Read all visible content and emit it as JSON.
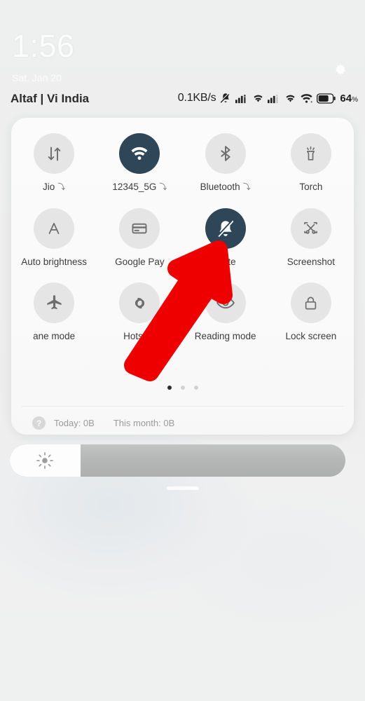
{
  "lockscreen": {
    "clock": "1:56",
    "date": "Sat, Jan 20",
    "carrier": "Altaf | Vi India",
    "settings_icon": "gear-icon"
  },
  "statusbar": {
    "network_speed": "0.1KB/s",
    "icons": [
      "mute-bell-icon",
      "signal-bars-icon",
      "data-3g-icon",
      "signal-bars-icon",
      "data-3g-icon",
      "wifi-icon",
      "battery-icon"
    ],
    "battery_percent": "64",
    "battery_percent_symbol": "%"
  },
  "control_center": {
    "tiles": [
      {
        "label": "Jio",
        "icon": "data-transfer-icon",
        "active": false,
        "expandable": true,
        "expand_glyph": "⤵"
      },
      {
        "label": "12345_5G",
        "icon": "wifi-icon",
        "active": true,
        "expandable": true,
        "expand_glyph": "⤵"
      },
      {
        "label": "Bluetooth",
        "icon": "bluetooth-icon",
        "active": false,
        "expandable": true,
        "expand_glyph": "⤵"
      },
      {
        "label": "Torch",
        "icon": "flashlight-icon",
        "active": false,
        "expandable": false,
        "expand_glyph": ""
      },
      {
        "label": "Auto brightness",
        "icon": "auto-brightness-icon",
        "active": false,
        "expandable": false,
        "expand_glyph": ""
      },
      {
        "label": "Google Pay",
        "icon": "card-icon",
        "active": false,
        "expandable": false,
        "expand_glyph": ""
      },
      {
        "label": "Mute",
        "icon": "mute-bell-icon",
        "active": true,
        "expandable": false,
        "expand_glyph": ""
      },
      {
        "label": "Screenshot",
        "icon": "screenshot-scissors-icon",
        "active": false,
        "expandable": false,
        "expand_glyph": ""
      },
      {
        "label": "ane mode",
        "icon": "airplane-icon",
        "active": false,
        "expandable": false,
        "expand_glyph": ""
      },
      {
        "label": "Hotspot",
        "icon": "hotspot-icon",
        "active": false,
        "expandable": false,
        "expand_glyph": ""
      },
      {
        "label": "Reading mode",
        "icon": "eye-icon",
        "active": false,
        "expandable": false,
        "expand_glyph": ""
      },
      {
        "label": "Lock screen",
        "icon": "padlock-icon",
        "active": false,
        "expandable": false,
        "expand_glyph": ""
      }
    ],
    "pages": {
      "count": 3,
      "active_index": 0
    },
    "data_usage": {
      "help_icon": "question-mark-icon",
      "help_glyph": "?",
      "today": "Today: 0B",
      "this_month": "This month: 0B"
    }
  },
  "brightness": {
    "icon": "sun-icon",
    "level_percent": 21
  },
  "annotation": {
    "arrow": "red-arrow-pointing-to-mute-tile",
    "color": "#ee0000"
  },
  "colors": {
    "tile_active": "#2f4658",
    "tile_inactive": "#e5e5e5",
    "panel": "#fafafa",
    "accent_red": "#ee0000"
  }
}
